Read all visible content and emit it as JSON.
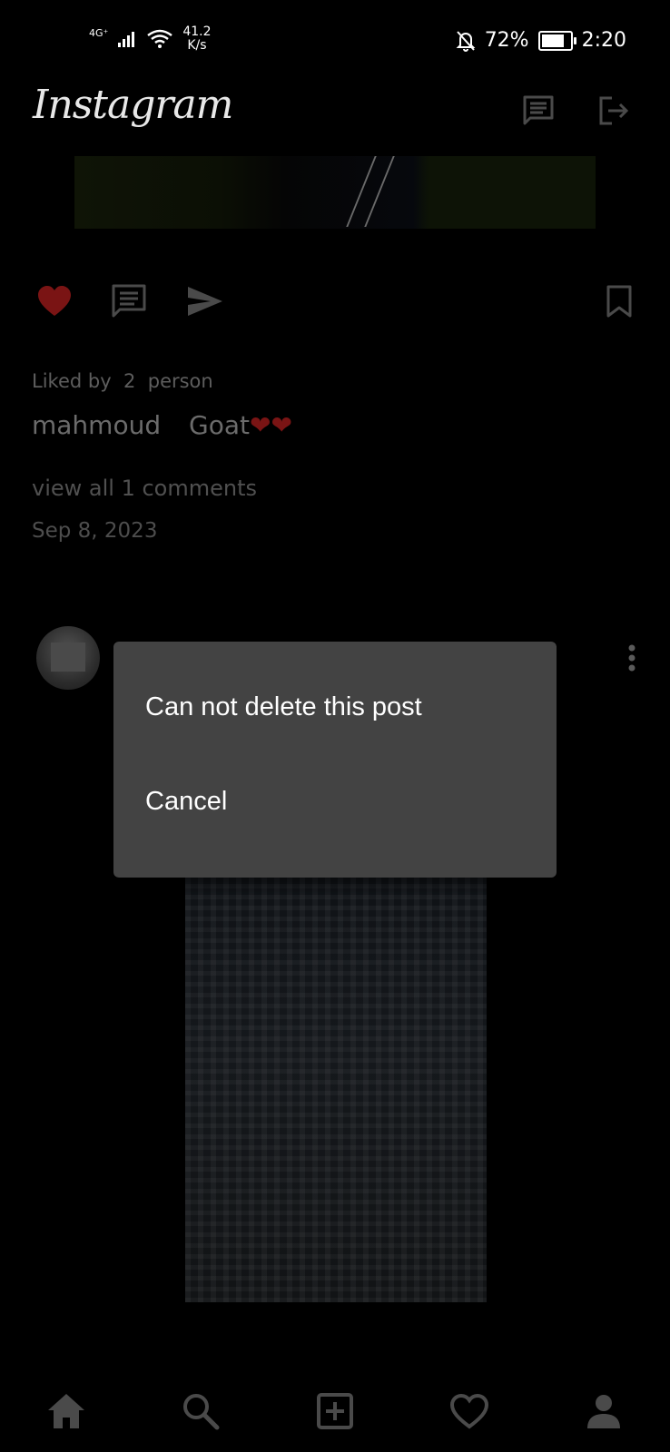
{
  "status_bar": {
    "network": "4G⁺",
    "speed_value": "41.2",
    "speed_unit": "K/s",
    "battery": "72%",
    "time": "2:20"
  },
  "header": {
    "logo": "Instagram",
    "icons": [
      "chat-icon",
      "logout-icon"
    ]
  },
  "post": {
    "liked_by_label": "Liked by",
    "liked_by_count": "2",
    "liked_by_unit": "person",
    "username": "mahmoud",
    "caption_text": "Goat",
    "caption_emoji": "❤❤",
    "view_comments": "view all 1 comments",
    "date": "Sep 8, 2023"
  },
  "dialog": {
    "option_1": "Can not delete this post",
    "option_2": "Cancel"
  },
  "bottom_nav": {
    "items": [
      "home-icon",
      "search-icon",
      "add-post-icon",
      "activity-heart-icon",
      "profile-icon"
    ]
  },
  "colors": {
    "background": "#000000",
    "dialog": "#434343",
    "like_red": "#7a1414",
    "nav_icon": "#4a4a4a"
  }
}
